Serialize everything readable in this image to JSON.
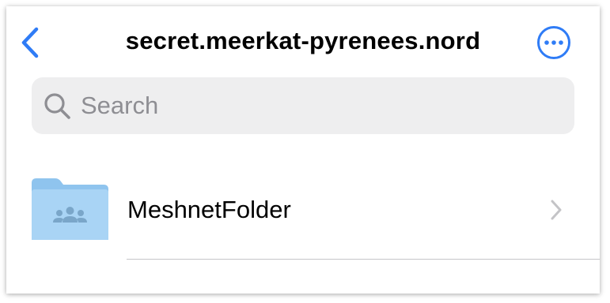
{
  "nav": {
    "title": "secret.meerkat-pyrenees.nord",
    "back_icon": "chevron-left-icon",
    "more_icon": "ellipsis-circle-icon"
  },
  "search": {
    "placeholder": "Search",
    "value": "",
    "icon": "magnifier-icon"
  },
  "items": [
    {
      "label": "MeshnetFolder",
      "icon": "shared-folder-icon",
      "disclosure_icon": "chevron-right-icon"
    }
  ],
  "colors": {
    "accent": "#2f7cf6",
    "search_bg": "#eeeeef",
    "placeholder": "#8e8e93",
    "folder": "#a9d4f5",
    "separator": "#c6c6c8",
    "chevron": "#c4c4c7"
  }
}
